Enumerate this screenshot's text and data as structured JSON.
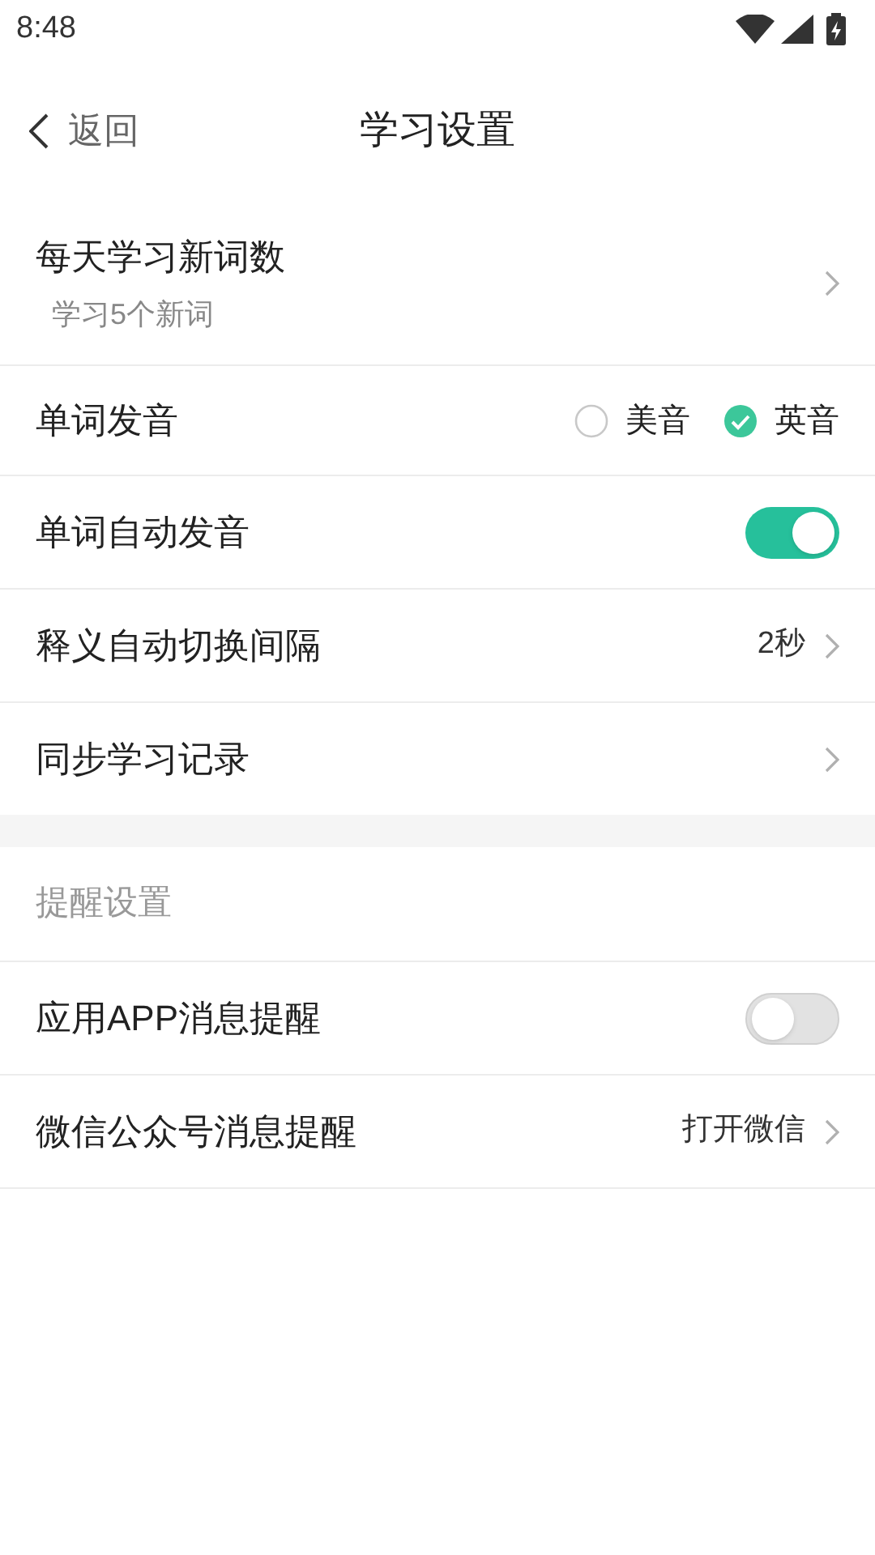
{
  "status_bar": {
    "time": "8:48"
  },
  "header": {
    "back_label": "返回",
    "title": "学习设置"
  },
  "study_rows": [
    {
      "kind": "nav",
      "label": "每天学习新词数",
      "sublabel": "学习5个新词"
    },
    {
      "kind": "radio",
      "label": "单词发音",
      "options": [
        {
          "label": "美音",
          "selected": false
        },
        {
          "label": "英音",
          "selected": true
        }
      ]
    },
    {
      "kind": "toggle",
      "label": "单词自动发音",
      "on": true
    },
    {
      "kind": "nav",
      "label": "释义自动切换间隔",
      "value": "2秒"
    },
    {
      "kind": "nav",
      "label": "同步学习记录"
    }
  ],
  "reminder_section": {
    "title": "提醒设置",
    "rows": [
      {
        "kind": "toggle",
        "label": "应用APP消息提醒",
        "on": false
      },
      {
        "kind": "nav",
        "label": "微信公众号消息提醒",
        "value": "打开微信"
      }
    ]
  }
}
